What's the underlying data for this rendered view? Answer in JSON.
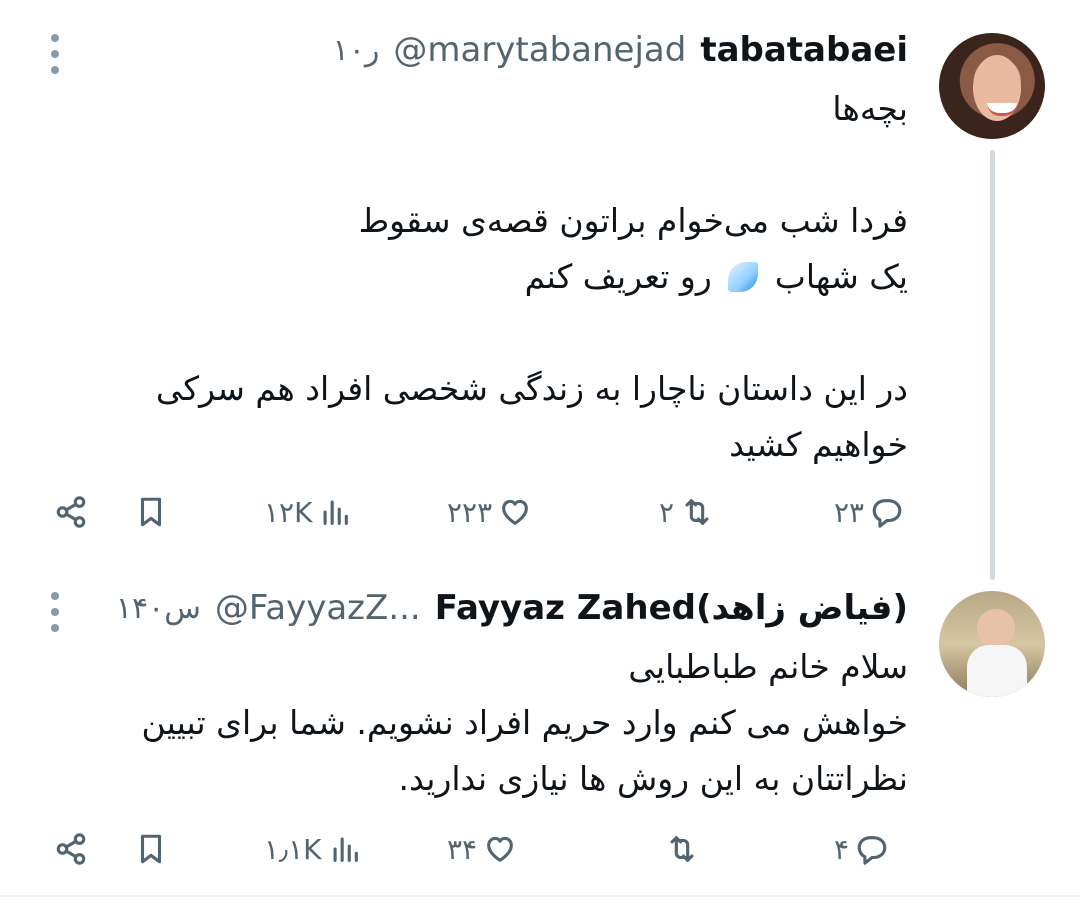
{
  "tweets": [
    {
      "author_name": "tabatabaei",
      "handle": "@marytabanejad",
      "time": "۱۰ر",
      "lines_a": [
        "بچه‌ها"
      ],
      "lines_b": [
        "فردا شب می‌خوام براتون قصه‌ی سقوط",
        "یک شهاب",
        "رو تعریف کنم"
      ],
      "lines_c": [
        "در این داستان ناچارا به زندگی شخصی افراد هم سرکی",
        "خواهیم کشید"
      ],
      "emoji": "comet-emoji",
      "replies": "۲۳",
      "reposts": "۲",
      "likes": "۲۲۳",
      "views": "۱۲K"
    },
    {
      "author_name": "Fayyaz Zahed(فیاض زاهد)",
      "handle": "@FayyazZ...",
      "time": "۱۴۰س",
      "lines": [
        "سلام خانم طباطبایی",
        "خواهش می کنم وارد حریم افراد نشویم. شما برای تبیین",
        "نظراتتان به این روش ها نیازی ندارید."
      ],
      "replies": "۴",
      "reposts": "",
      "likes": "۳۴",
      "views": "۱٫۱K"
    }
  ],
  "colors": {
    "text": "#0f1419",
    "muted": "#536471",
    "thread_line": "#cfd9de"
  },
  "icons": [
    "more-icon",
    "reply-icon",
    "repost-icon",
    "like-icon",
    "views-icon",
    "bookmark-icon",
    "share-icon"
  ]
}
